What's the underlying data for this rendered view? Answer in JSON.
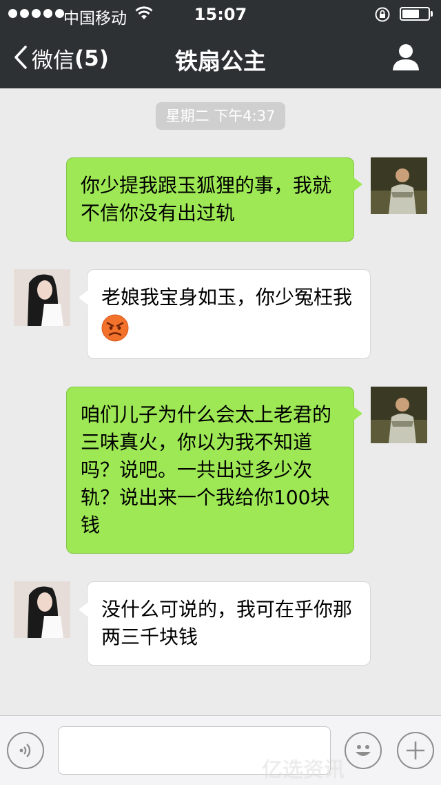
{
  "status_bar": {
    "carrier": "中国移动",
    "time": "15:07"
  },
  "nav": {
    "back_label": "微信",
    "unread_count": "(5)",
    "title": "铁扇公主"
  },
  "chat": {
    "timestamp": "星期二 下午4:37",
    "messages": [
      {
        "sender": "me",
        "lines": [
          "你少提我跟玉狐狸的事，我就",
          "不信你没有出过轨"
        ]
      },
      {
        "sender": "them",
        "lines": [
          "老娘我宝身如玉，你少冤枉我"
        ],
        "emoji": "angry-face-icon"
      },
      {
        "sender": "me",
        "lines": [
          "咱们儿子为什么会太上老君的",
          "三味真火，你以为我不知道",
          "吗？说吧。一共出过多少次",
          "轨？说出来一个我给你100块",
          "钱"
        ]
      },
      {
        "sender": "them",
        "lines": [
          "没什么可说的，我可在乎你那",
          "两三千块钱"
        ]
      }
    ]
  },
  "input_bar": {
    "text_value": ""
  },
  "watermark": "亿选资讯",
  "colors": {
    "header_bg": "#2e3134",
    "chat_bg": "#ebebeb",
    "my_bubble": "#9de854",
    "their_bubble": "#ffffff"
  }
}
